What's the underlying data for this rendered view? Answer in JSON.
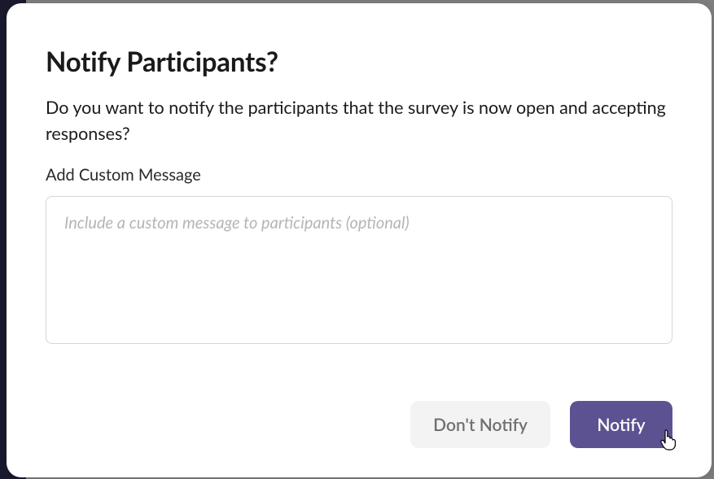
{
  "modal": {
    "title": "Notify Participants?",
    "description": "Do you want to notify the participants that the survey is now open and accepting responses?",
    "field_label": "Add Custom Message",
    "textarea_placeholder": "Include a custom message to participants (optional)",
    "textarea_value": "",
    "buttons": {
      "secondary": "Don't Notify",
      "primary": "Notify"
    }
  }
}
